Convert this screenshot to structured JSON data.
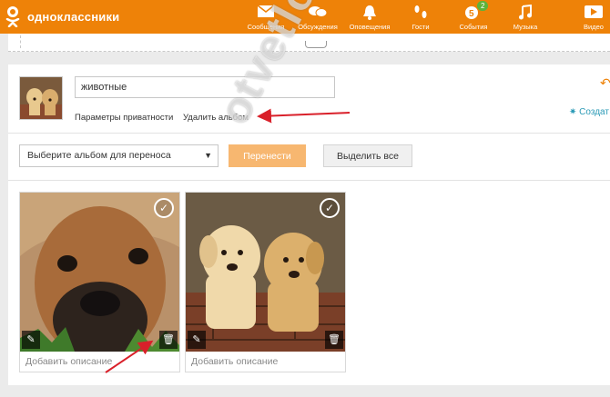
{
  "brand": {
    "name": "одноклассники"
  },
  "nav": [
    {
      "label": "Сообщения",
      "icon": "envelope-icon"
    },
    {
      "label": "Обсуждения",
      "icon": "chat-icon"
    },
    {
      "label": "Оповещения",
      "icon": "bell-icon"
    },
    {
      "label": "Гости",
      "icon": "footprints-icon"
    },
    {
      "label": "События",
      "icon": "events-icon",
      "badge": "2"
    },
    {
      "label": "Музыка",
      "icon": "music-icon"
    },
    {
      "label": "Видео",
      "icon": "video-icon"
    }
  ],
  "album": {
    "name_value": "животные",
    "privacy_link": "Параметры приватности",
    "delete_link": "Удалить альбом",
    "create_link": "Создат"
  },
  "move": {
    "select_placeholder": "Выберите альбом для переноса",
    "move_button": "Перенести",
    "select_all_button": "Выделить все"
  },
  "photos": [
    {
      "caption_placeholder": "Добавить описание"
    },
    {
      "caption_placeholder": "Добавить описание"
    }
  ],
  "watermark": "otvetlo.ru",
  "colors": {
    "brand": "#ee8208",
    "move_button": "#f7b770",
    "arrow": "#d9202a",
    "link_accent": "#2b9ab6"
  }
}
